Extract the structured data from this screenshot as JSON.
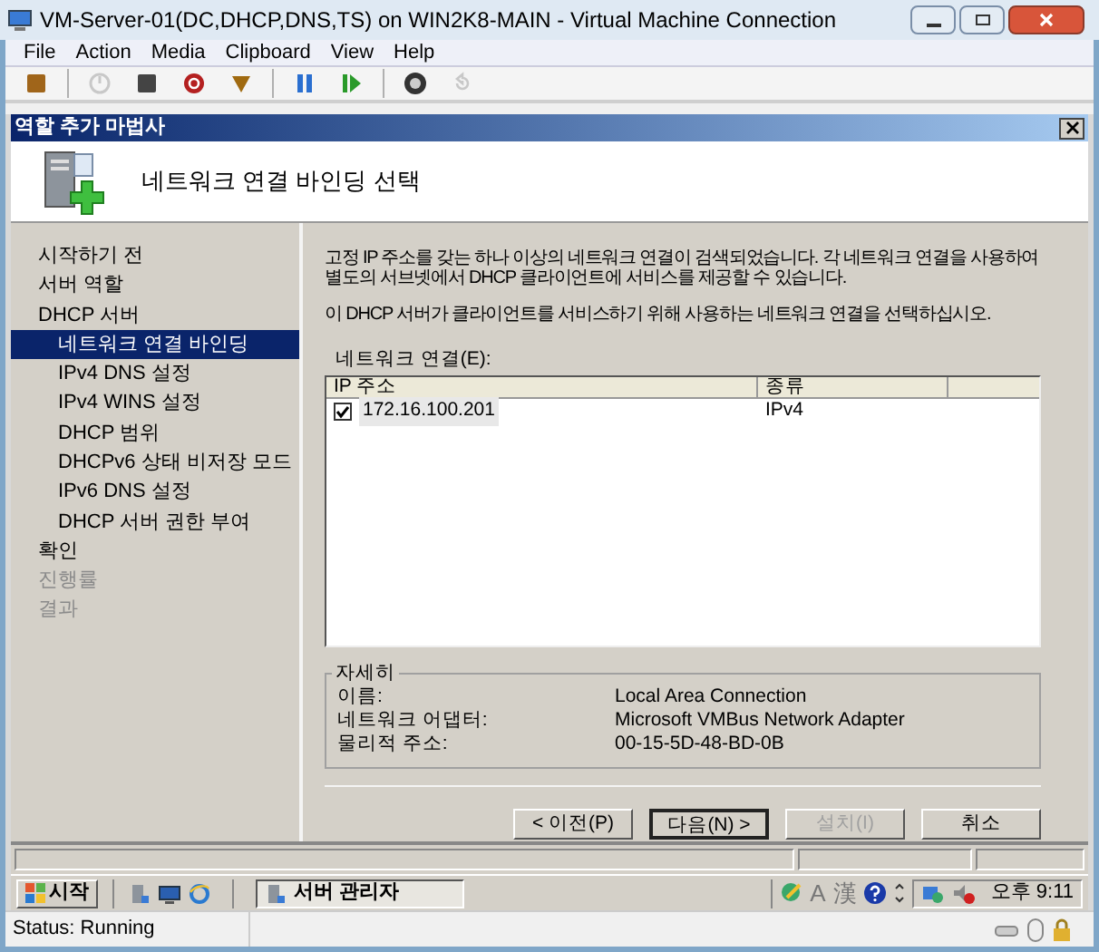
{
  "window": {
    "title": "VM-Server-01(DC,DHCP,DNS,TS) on WIN2K8-MAIN - Virtual Machine Connection"
  },
  "menu": [
    "File",
    "Action",
    "Media",
    "Clipboard",
    "View",
    "Help"
  ],
  "toolbar": [
    {
      "kind": "ctrl-alt-del",
      "disabled": false
    },
    {
      "kind": "sep"
    },
    {
      "kind": "start",
      "disabled": true
    },
    {
      "kind": "turn-off",
      "disabled": false
    },
    {
      "kind": "shutdown",
      "disabled": false
    },
    {
      "kind": "save",
      "disabled": false
    },
    {
      "kind": "sep"
    },
    {
      "kind": "pause",
      "disabled": false
    },
    {
      "kind": "reset",
      "disabled": false
    },
    {
      "kind": "sep"
    },
    {
      "kind": "snapshot",
      "disabled": false
    },
    {
      "kind": "revert",
      "disabled": true
    }
  ],
  "wizard": {
    "title": "역할 추가 마법사",
    "heading": "네트워크 연결 바인딩 선택",
    "nav": [
      {
        "label": "시작하기 전",
        "selected": false,
        "disabled": false
      },
      {
        "label": "서버 역할",
        "selected": false,
        "disabled": false
      },
      {
        "label": "DHCP 서버",
        "selected": false,
        "disabled": false,
        "children": [
          {
            "label": "네트워크 연결 바인딩",
            "selected": true,
            "disabled": false
          },
          {
            "label": "IPv4 DNS 설정",
            "selected": false,
            "disabled": false
          },
          {
            "label": "IPv4 WINS 설정",
            "selected": false,
            "disabled": false
          },
          {
            "label": "DHCP 범위",
            "selected": false,
            "disabled": false
          },
          {
            "label": "DHCPv6 상태 비저장 모드",
            "selected": false,
            "disabled": false
          },
          {
            "label": "IPv6 DNS 설정",
            "selected": false,
            "disabled": false
          },
          {
            "label": "DHCP 서버 권한 부여",
            "selected": false,
            "disabled": false
          }
        ]
      },
      {
        "label": "확인",
        "selected": false,
        "disabled": false
      },
      {
        "label": "진행률",
        "selected": false,
        "disabled": true
      },
      {
        "label": "결과",
        "selected": false,
        "disabled": true
      }
    ],
    "intro": "고정 IP 주소를 갖는 하나 이상의 네트워크 연결이 검색되었습니다. 각 네트워크 연결을 사용하여 별도의 서브넷에서 DHCP 클라이언트에 서비스를 제공할 수 있습니다.",
    "instruction": "이 DHCP 서버가 클라이언트를 서비스하기 위해 사용하는 네트워크 연결을 선택하십시오.",
    "connections": {
      "label": "네트워크 연결(E):",
      "columns": [
        "IP 주소",
        "종류"
      ],
      "rows": [
        {
          "ip": "172.16.100.201",
          "type": "IPv4",
          "checked": true
        }
      ]
    },
    "details": {
      "title": "자세히",
      "fields": [
        {
          "label": "이름:",
          "value": "Local Area Connection"
        },
        {
          "label": "네트워크 어댑터:",
          "value": "Microsoft VMBus Network Adapter"
        },
        {
          "label": "물리적 주소:",
          "value": "00-15-5D-48-BD-0B"
        }
      ]
    },
    "buttons": [
      {
        "label": "< 이전(P)",
        "disabled": false,
        "default": false
      },
      {
        "label": "다음(N) >",
        "disabled": false,
        "default": true
      },
      {
        "label": "설치(I)",
        "disabled": true,
        "default": false
      },
      {
        "label": "취소",
        "disabled": false,
        "default": false
      }
    ]
  },
  "taskbar": {
    "start": "시작",
    "task": "서버 관리자",
    "ime": [
      "A",
      "漢"
    ],
    "clock": "오후 9:11"
  },
  "status_bar": {
    "text": "Status: Running"
  }
}
